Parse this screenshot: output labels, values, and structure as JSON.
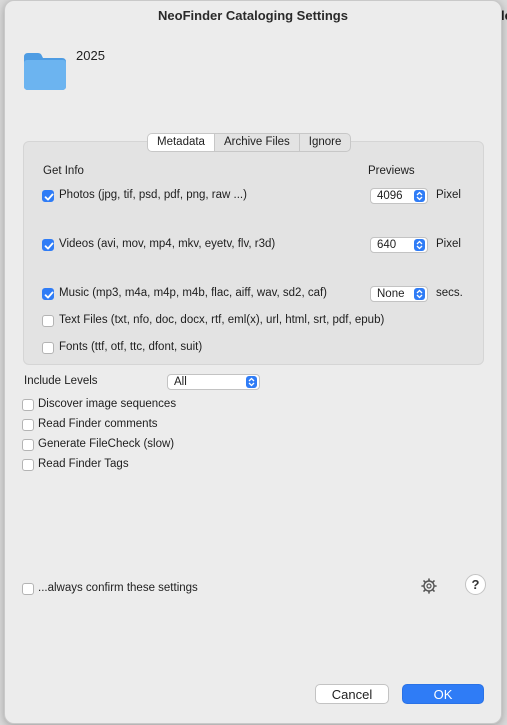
{
  "background": {
    "fragment": "le"
  },
  "window": {
    "title": "NeoFinder Cataloging Settings"
  },
  "folder": {
    "name": "2025",
    "icon": "folder-icon"
  },
  "tabs": [
    {
      "label": "Metadata",
      "selected": true
    },
    {
      "label": "Archive Files",
      "selected": false
    },
    {
      "label": "Ignore",
      "selected": false
    }
  ],
  "metadata": {
    "get_info_header": "Get Info",
    "previews_header": "Previews",
    "photos": {
      "label": "Photos (jpg, tif, psd, pdf, png, raw ...)",
      "checked": true,
      "preview": "4096",
      "unit": "Pixel"
    },
    "videos": {
      "label": "Videos (avi, mov, mp4, mkv, eyetv, flv, r3d)",
      "checked": true,
      "preview": "640",
      "unit": "Pixel"
    },
    "music": {
      "label": "Music (mp3, m4a, m4p, m4b, flac, aiff, wav, sd2, caf)",
      "checked": true,
      "preview": "None",
      "unit": "secs."
    },
    "text_files": {
      "label": "Text Files (txt, nfo, doc, docx, rtf, eml(x), url, html, srt, pdf, epub)",
      "checked": false
    },
    "fonts": {
      "label": "Fonts (ttf, otf, ttc, dfont, suit)",
      "checked": false
    }
  },
  "include_levels": {
    "label": "Include Levels",
    "value": "All"
  },
  "options": [
    {
      "label": "Discover image sequences",
      "checked": false
    },
    {
      "label": "Read Finder comments",
      "checked": false
    },
    {
      "label": "Generate FileCheck (slow)",
      "checked": false
    },
    {
      "label": "Read Finder Tags",
      "checked": false
    }
  ],
  "confirm": {
    "label": "...always confirm these settings",
    "checked": false
  },
  "help": {
    "label": "?"
  },
  "buttons": {
    "cancel": "Cancel",
    "ok": "OK"
  },
  "colors": {
    "accent": "#2f7cf6",
    "folder": "#6cb4f0",
    "dialog_bg": "#ececec",
    "group_bg": "#e3e3e3"
  }
}
